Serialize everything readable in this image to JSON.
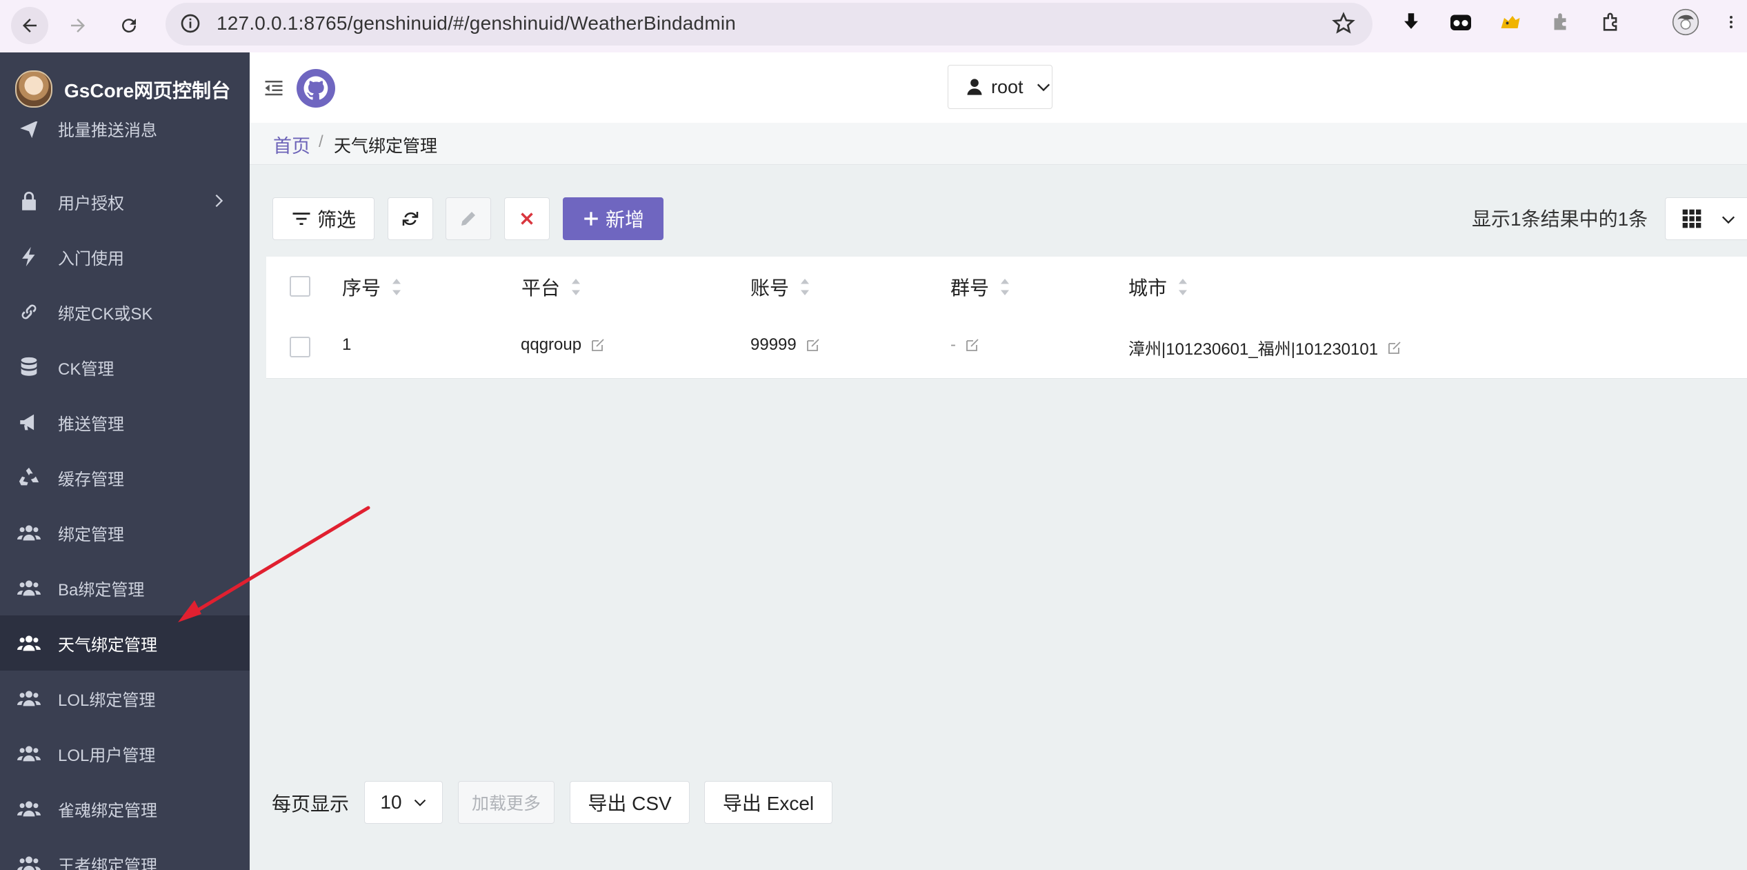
{
  "browser": {
    "url": "127.0.0.1:8765/genshinuid/#/genshinuid/WeatherBindadmin"
  },
  "sidebar": {
    "brand_title": "GsCore网页控制台",
    "partial_top_item": "批量推送消息",
    "items": [
      {
        "label": "用户授权",
        "icon": "lock-icon",
        "has_children": true
      },
      {
        "label": "入门使用",
        "icon": "bolt-icon"
      },
      {
        "label": "绑定CK或SK",
        "icon": "link-icon"
      },
      {
        "label": "CK管理",
        "icon": "database-icon"
      },
      {
        "label": "推送管理",
        "icon": "megaphone-icon"
      },
      {
        "label": "缓存管理",
        "icon": "recycle-icon"
      },
      {
        "label": "绑定管理",
        "icon": "users-icon"
      },
      {
        "label": "Ba绑定管理",
        "icon": "users-icon"
      },
      {
        "label": "天气绑定管理",
        "icon": "users-icon",
        "active": true
      },
      {
        "label": "LOL绑定管理",
        "icon": "users-icon"
      },
      {
        "label": "LOL用户管理",
        "icon": "users-icon"
      },
      {
        "label": "雀魂绑定管理",
        "icon": "users-icon"
      },
      {
        "label": "王者绑定管理",
        "icon": "users-icon"
      }
    ]
  },
  "header": {
    "user_name": "root"
  },
  "breadcrumb": {
    "home": "首页",
    "separator": "/",
    "current": "天气绑定管理"
  },
  "toolbar": {
    "filter_label": "筛选",
    "new_label": "新增",
    "result_count": "显示1条结果中的1条"
  },
  "table": {
    "columns": [
      "序号",
      "平台",
      "账号",
      "群号",
      "城市"
    ],
    "rows": [
      {
        "id": "1",
        "platform": "qqgroup",
        "account": "99999",
        "group": "-",
        "city": "漳州|101230601_福州|101230101"
      }
    ]
  },
  "footer": {
    "per_page_label": "每页显示",
    "per_page_value": "10",
    "load_more": "加载更多",
    "export_csv": "导出 CSV",
    "export_excel": "导出 Excel"
  },
  "colors": {
    "sidebar_bg": "#3a3f51",
    "accent": "#6f66c0",
    "delete_red": "#d9363e"
  }
}
